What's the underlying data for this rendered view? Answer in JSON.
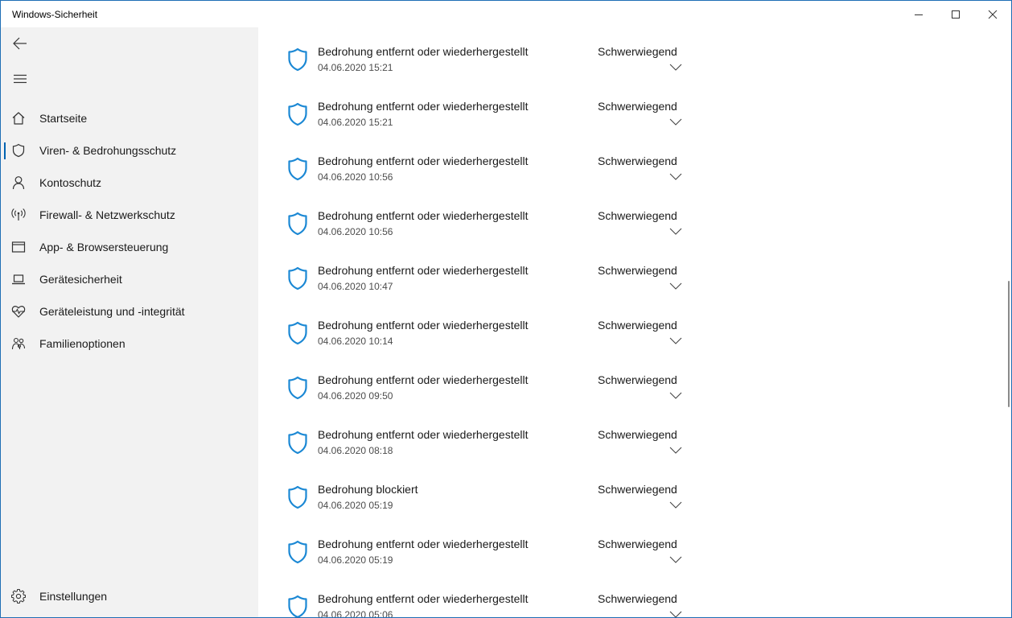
{
  "window": {
    "title": "Windows-Sicherheit",
    "accent": "#0063b1",
    "shield_color": "#1b88d4"
  },
  "sidebar": {
    "items": [
      {
        "label": "Startseite",
        "icon": "home-icon"
      },
      {
        "label": "Viren- & Bedrohungsschutz",
        "icon": "shield-icon",
        "active": true
      },
      {
        "label": "Kontoschutz",
        "icon": "person-icon"
      },
      {
        "label": "Firewall- & Netzwerkschutz",
        "icon": "antenna-icon"
      },
      {
        "label": "App- & Browsersteuerung",
        "icon": "browser-window-icon"
      },
      {
        "label": "Gerätesicherheit",
        "icon": "laptop-icon"
      },
      {
        "label": "Geräteleistung und -integrität",
        "icon": "heart-pulse-icon"
      },
      {
        "label": "Familienoptionen",
        "icon": "family-icon"
      }
    ],
    "settings_label": "Einstellungen"
  },
  "threats": [
    {
      "title": "Bedrohung entfernt oder wiederhergestellt",
      "date": "04.06.2020 15:21",
      "severity": "Schwerwiegend"
    },
    {
      "title": "Bedrohung entfernt oder wiederhergestellt",
      "date": "04.06.2020 15:21",
      "severity": "Schwerwiegend"
    },
    {
      "title": "Bedrohung entfernt oder wiederhergestellt",
      "date": "04.06.2020 10:56",
      "severity": "Schwerwiegend"
    },
    {
      "title": "Bedrohung entfernt oder wiederhergestellt",
      "date": "04.06.2020 10:56",
      "severity": "Schwerwiegend"
    },
    {
      "title": "Bedrohung entfernt oder wiederhergestellt",
      "date": "04.06.2020 10:47",
      "severity": "Schwerwiegend"
    },
    {
      "title": "Bedrohung entfernt oder wiederhergestellt",
      "date": "04.06.2020 10:14",
      "severity": "Schwerwiegend"
    },
    {
      "title": "Bedrohung entfernt oder wiederhergestellt",
      "date": "04.06.2020 09:50",
      "severity": "Schwerwiegend"
    },
    {
      "title": "Bedrohung entfernt oder wiederhergestellt",
      "date": "04.06.2020 08:18",
      "severity": "Schwerwiegend"
    },
    {
      "title": "Bedrohung blockiert",
      "date": "04.06.2020 05:19",
      "severity": "Schwerwiegend"
    },
    {
      "title": "Bedrohung entfernt oder wiederhergestellt",
      "date": "04.06.2020 05:19",
      "severity": "Schwerwiegend"
    },
    {
      "title": "Bedrohung entfernt oder wiederhergestellt",
      "date": "04.06.2020 05:06",
      "severity": "Schwerwiegend"
    }
  ]
}
